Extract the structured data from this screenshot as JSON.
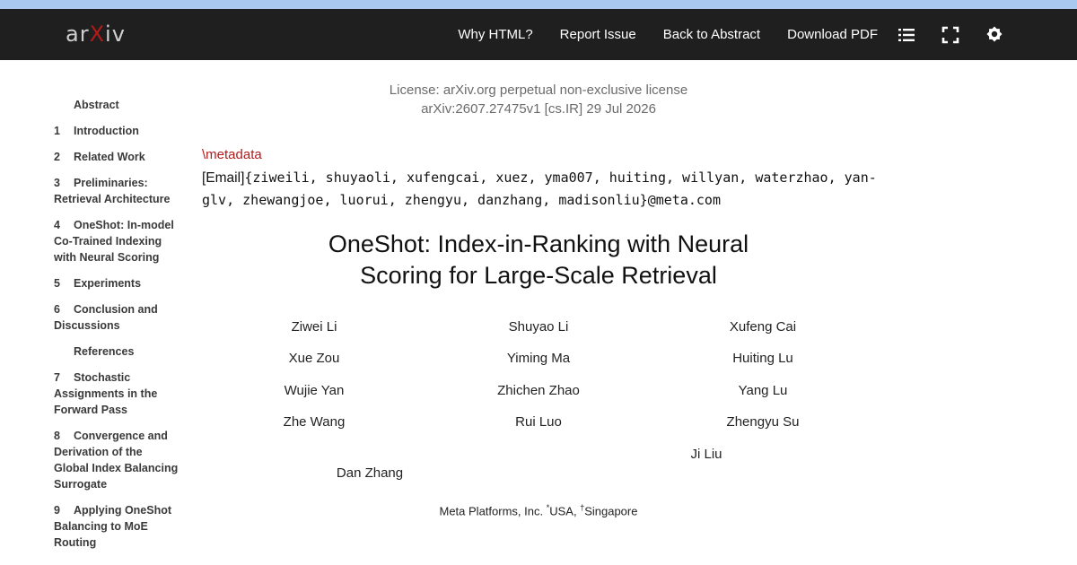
{
  "navbar": {
    "logo": {
      "left": "ar",
      "x": "X",
      "right": "iv"
    },
    "links": [
      "Why HTML?",
      "Report Issue",
      "Back to Abstract",
      "Download PDF"
    ],
    "icons": [
      "list-icon",
      "fullscreen-icon",
      "theme-icon"
    ]
  },
  "toc": [
    {
      "num": "",
      "label": "Abstract"
    },
    {
      "num": "1",
      "label": "Introduction"
    },
    {
      "num": "2",
      "label": "Related Work"
    },
    {
      "num": "3",
      "label": "Preliminaries: Retrieval Architecture"
    },
    {
      "num": "4",
      "label": "OneShot: In-model Co-Trained Indexing with Neural Scoring"
    },
    {
      "num": "5",
      "label": "Experiments"
    },
    {
      "num": "6",
      "label": "Conclusion and Discussions"
    },
    {
      "num": "",
      "label": "References"
    },
    {
      "num": "7",
      "label": "Stochastic Assignments in the Forward Pass"
    },
    {
      "num": "8",
      "label": "Convergence and Derivation of the Global Index Balancing Surrogate"
    },
    {
      "num": "9",
      "label": "Applying OneShot Balancing to MoE Routing"
    }
  ],
  "header": {
    "license": "License: arXiv.org perpetual non-exclusive license",
    "identifier": "arXiv:2607.27475v1 [cs.IR] 29 Jul 2026"
  },
  "metadata": {
    "command": "\\metadata",
    "email_prefix": "[Email]",
    "email_body": "{ziweili, shuyaoli, xufengcai, xuez, yma007, huiting, willyan, waterzhao, yan-glv, zhewangjoe, luorui, zhengyu, danzhang, madisonliu}@meta.com"
  },
  "title": "OneShot: Index-in-Ranking with Neural Scoring for Large-Scale Retrieval",
  "authors": [
    "Ziwei Li",
    "Shuyao Li",
    "Xufeng Cai",
    "Xue Zou",
    "Yiming Ma",
    "Huiting Lu",
    "Wujie Yan",
    "Zhichen Zhao",
    "Yang Lu",
    "Zhe Wang",
    "Rui Luo",
    "Zhengyu Su",
    "Ji Liu",
    "Dan Zhang"
  ],
  "affiliation": {
    "org": "Meta Platforms, Inc. ",
    "mark1": "*",
    "loc1": "USA, ",
    "mark2": "†",
    "loc2": "Singapore"
  }
}
